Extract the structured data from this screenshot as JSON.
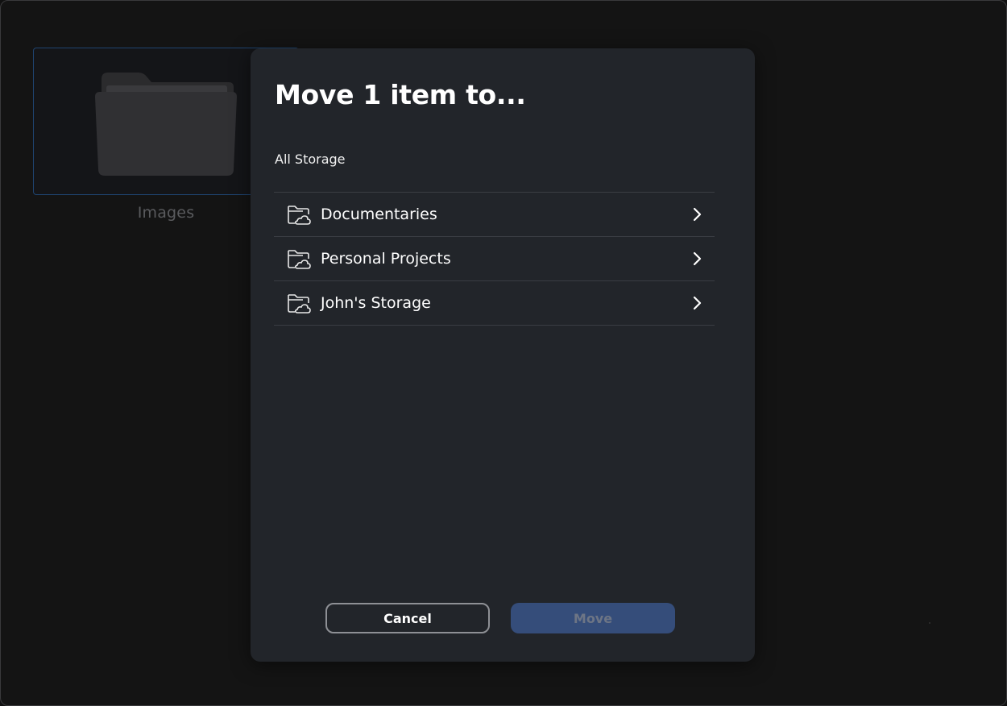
{
  "background": {
    "folder_label": "Images",
    "folder_icon": "folder-icon"
  },
  "modal": {
    "title": "Move 1 item to...",
    "breadcrumb": "All Storage",
    "folders": [
      {
        "label": "Documentaries",
        "icon": "cloud-folder-icon"
      },
      {
        "label": "Personal Projects",
        "icon": "cloud-folder-icon"
      },
      {
        "label": "John's Storage",
        "icon": "cloud-folder-icon"
      }
    ],
    "cancel_label": "Cancel",
    "move_label": "Move"
  },
  "colors": {
    "modal_bg": "#22252a",
    "move_button_disabled": "#354d7a",
    "selection_border": "#1f4470"
  }
}
